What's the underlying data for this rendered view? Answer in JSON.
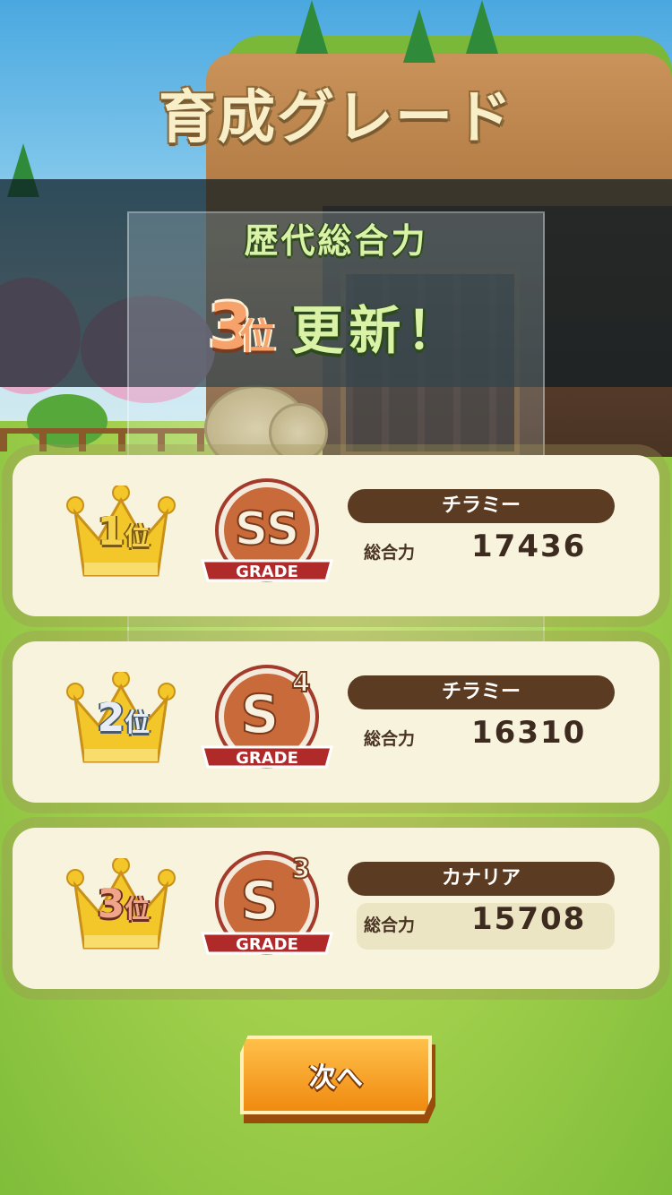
{
  "screen": {
    "title": "育成グレード",
    "banner": {
      "subtitle": "歴代総合力",
      "rank_number": "3",
      "rank_suffix": "位",
      "update_text": "更新！"
    },
    "rankings": [
      {
        "rank_number": "1",
        "rank_suffix": "位",
        "grade": "SS",
        "grade_caption": "GRADE",
        "name": "チラミー",
        "stat_label": "総合力",
        "value": "17436",
        "crown_color": "#f3c62a",
        "label_color": "#f6d24a"
      },
      {
        "rank_number": "2",
        "rank_suffix": "位",
        "grade": "S",
        "grade_sup": "4",
        "grade_caption": "GRADE",
        "name": "チラミー",
        "stat_label": "総合力",
        "value": "16310",
        "crown_color": "#f3c62a",
        "label_color": "#dfe6ee"
      },
      {
        "rank_number": "3",
        "rank_suffix": "位",
        "grade": "S",
        "grade_sup": "3",
        "grade_caption": "GRADE",
        "name": "カナリア",
        "stat_label": "総合力",
        "value": "15708",
        "crown_color": "#f3c62a",
        "label_color": "#f0a58a"
      }
    ],
    "next_button": "次へ"
  }
}
